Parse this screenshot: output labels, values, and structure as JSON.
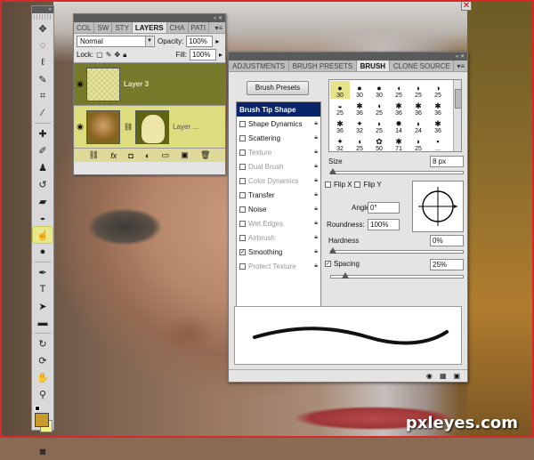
{
  "layers_panel": {
    "tabs": [
      "COL",
      "SW",
      "STY",
      "LAYERS",
      "CHA",
      "PATI"
    ],
    "active_tab": "LAYERS",
    "blend_mode": "Normal",
    "opacity_label": "Opacity:",
    "opacity_value": "100%",
    "lock_label": "Lock:",
    "fill_label": "Fill:",
    "fill_value": "100%",
    "layers": [
      {
        "name": "Layer 3",
        "selected": true
      },
      {
        "name": "Layer ...",
        "selected": false
      }
    ],
    "footer_icons": [
      "link-icon",
      "fx-icon",
      "mask-icon",
      "adjustment-icon",
      "folder-icon",
      "new-layer-icon",
      "trash-icon"
    ]
  },
  "brush_panel": {
    "tabs": [
      "ADJUSTMENTS",
      "BRUSH PRESETS",
      "BRUSH",
      "CLONE SOURCE"
    ],
    "active_tab": "BRUSH",
    "presets_button": "Brush Presets",
    "options": [
      {
        "label": "Brush Tip Shape",
        "header": true
      },
      {
        "label": "Shape Dynamics",
        "checked": false,
        "dim": false
      },
      {
        "label": "Scattering",
        "checked": false,
        "dim": false
      },
      {
        "label": "Texture",
        "checked": false,
        "dim": true
      },
      {
        "label": "Dual Brush",
        "checked": false,
        "dim": true
      },
      {
        "label": "Color Dynamics",
        "checked": false,
        "dim": true
      },
      {
        "label": "Transfer",
        "checked": false,
        "dim": false
      },
      {
        "label": "Noise",
        "checked": false,
        "dim": false
      },
      {
        "label": "Wet Edges",
        "checked": false,
        "dim": true
      },
      {
        "label": "Airbrush",
        "checked": false,
        "dim": true
      },
      {
        "label": "Smoothing",
        "checked": true,
        "dim": false
      },
      {
        "label": "Protect Texture",
        "checked": false,
        "dim": true
      }
    ],
    "tip_sizes": [
      "30",
      "30",
      "30",
      "25",
      "25",
      "25",
      "25",
      "36",
      "25",
      "36",
      "36",
      "36",
      "36",
      "32",
      "25",
      "14",
      "24",
      "36",
      "32",
      "25",
      "50",
      "71",
      "25",
      "..."
    ],
    "size_label": "Size",
    "size_value": "8 px",
    "flip_x": "Flip X",
    "flip_y": "Flip Y",
    "angle_label": "Angle:",
    "angle_value": "0°",
    "roundness_label": "Roundness:",
    "roundness_value": "100%",
    "hardness_label": "Hardness",
    "hardness_value": "0%",
    "spacing_label": "Spacing",
    "spacing_value": "25%",
    "spacing_checked": true
  },
  "watermark": "pxleyes.com"
}
